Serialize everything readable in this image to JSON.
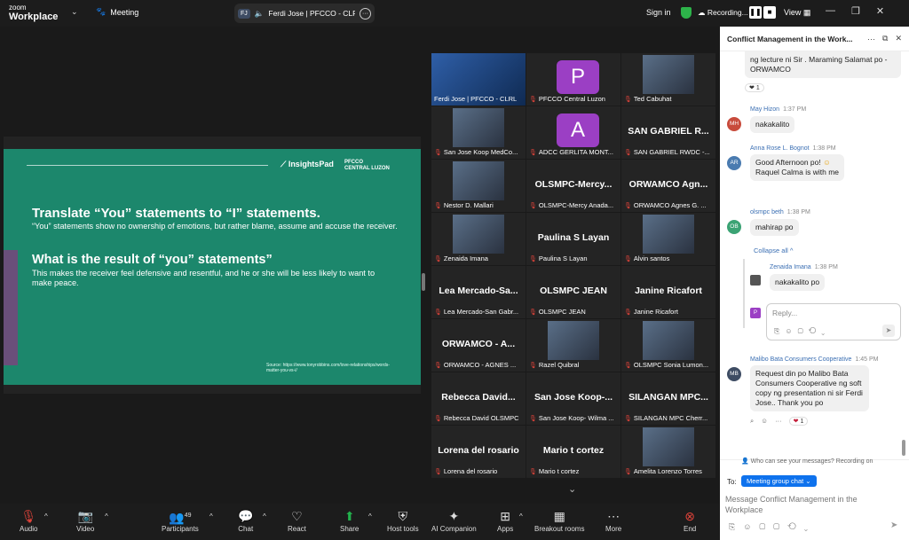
{
  "topbar": {
    "brand_small": "zoom",
    "brand_large": "Workplace",
    "meeting_label": "Meeting",
    "speaker_initials": "FJ",
    "speaker_name": "Ferdi Jose | PFCCO - CLRL's s",
    "signin": "Sign in",
    "recording": "Recording...",
    "view": "View"
  },
  "slide": {
    "logo1": "InsightsPad",
    "logo2_top": "PFCCO",
    "logo2_bottom": "CENTRAL LUZON",
    "heading1": "Translate “You” statements to “I” statements.",
    "para1": "“You” statements show no ownership of emotions, but rather blame, assume and accuse the receiver.",
    "heading2": "What is the result of “you” statements”",
    "para2": "This makes the receiver  feel defensive and resentful, and he or she will be less likely to want to make peace.",
    "source": "Source: https://www.tonyrobbins.com/love-relationships/words-matter-you-vs-i/"
  },
  "tiles": [
    {
      "name": "Ferdi Jose | PFCCO - CLRL",
      "kind": "photo",
      "active": true,
      "muted": false
    },
    {
      "name": "PFCCO Central Luzon",
      "kind": "avatar",
      "letter": "P",
      "color": "#9b3fc4",
      "muted": true
    },
    {
      "name": "Ted Cabuhat",
      "kind": "photo",
      "muted": true
    },
    {
      "name": "San Jose Koop MedCo...",
      "kind": "photo",
      "muted": true
    },
    {
      "name": "ADCC GERLITA MONT...",
      "kind": "avatar",
      "letter": "A",
      "color": "#9b3fc4",
      "muted": true
    },
    {
      "name": "SAN GABRIEL RWDC -...",
      "kind": "text",
      "big": "SAN GABRIEL R...",
      "muted": true
    },
    {
      "name": "Nestor D. Mallari",
      "kind": "photo",
      "muted": true
    },
    {
      "name": "OLSMPC-Mercy Anada...",
      "kind": "text",
      "big": "OLSMPC-Mercy...",
      "muted": true
    },
    {
      "name": "ORWAMCO Agnes G. ...",
      "kind": "text",
      "big": "ORWAMCO  Agn...",
      "muted": true
    },
    {
      "name": "Zenaida Imana",
      "kind": "photo",
      "muted": true
    },
    {
      "name": "Paulina S Layan",
      "kind": "text",
      "big": "Paulina S Layan",
      "muted": true
    },
    {
      "name": "Alvin santos",
      "kind": "photo",
      "muted": true
    },
    {
      "name": "Lea Mercado-San Gabr...",
      "kind": "text",
      "big": "Lea  Mercado-Sa...",
      "muted": true
    },
    {
      "name": "OLSMPC JEAN",
      "kind": "text",
      "big": "OLSMPC JEAN",
      "muted": true
    },
    {
      "name": "Janine Ricafort",
      "kind": "text",
      "big": "Janine Ricafort",
      "muted": true
    },
    {
      "name": "ORWAMCO - AGNES ...",
      "kind": "text",
      "big": "ORWAMCO  - A...",
      "muted": true
    },
    {
      "name": "Razel Quibral",
      "kind": "photo",
      "muted": true
    },
    {
      "name": "OLSMPC Sonia Lumon...",
      "kind": "photo",
      "muted": true
    },
    {
      "name": "Rebecca David OLSMPC",
      "kind": "text",
      "big": "Rebecca  David...",
      "muted": true
    },
    {
      "name": "San Jose Koop- Wilma ...",
      "kind": "text",
      "big": "San Jose Koop-...",
      "muted": true
    },
    {
      "name": "SILANGAN MPC Cherr...",
      "kind": "text",
      "big": "SILANGAN  MPC...",
      "muted": true
    },
    {
      "name": "Lorena del rosario",
      "kind": "text",
      "big": "Lorena del rosario",
      "muted": true
    },
    {
      "name": "Mario t cortez",
      "kind": "text",
      "big": "Mario t cortez",
      "muted": true
    },
    {
      "name": "Amelita Lorenzo Torres",
      "kind": "photo",
      "muted": true
    }
  ],
  "toolbar": {
    "audio": "Audio",
    "video": "Video",
    "participants": "Participants",
    "participants_count": "49",
    "chat": "Chat",
    "react": "React",
    "share": "Share",
    "host_tools": "Host tools",
    "ai": "AI Companion",
    "apps": "Apps",
    "breakout": "Breakout rooms",
    "more": "More",
    "end": "End"
  },
  "chat": {
    "title": "Conflict Management in the Work...",
    "m0_text": "ng lecture ni Sir . Maraming Salamat po - ORWAMCO",
    "m0_react": "1",
    "m1_initials": "MH",
    "m1_name": "May Hizon",
    "m1_time": "1:37 PM",
    "m1_text": "nakakalito",
    "m2_initials": "AR",
    "m2_name": "Anna Rose L. Bognot",
    "m2_time": "1:38 PM",
    "m2_text": "Good Afternoon po!",
    "m2_text2": "Raquel Calma is with me",
    "m3_initials": "OB",
    "m3_name": "olsmpc beth",
    "m3_time": "1:38 PM",
    "m3_text": "mahirap po",
    "collapse": "Collapse all",
    "r1_name": "Zenaida Imana",
    "r1_time": "1:38 PM",
    "r1_text": "nakakalito po",
    "reply_placeholder": "Reply...",
    "m4_initials": "MB",
    "m4_name": "Malibo Bata Consumers Cooperative",
    "m4_time": "1:45 PM",
    "m4_text": "Request din po Malibo Bata Consumers Cooperative ng soft copy ng presentation ni sir Ferdi Jose.. Thank you po",
    "m4_react": "1",
    "who_can_see": "Who can see your messages? Recording on",
    "to_label": "To:",
    "to_value": "Meeting group chat",
    "input_placeholder": "Message Conflict Management in the Workplace"
  },
  "colors": {
    "slide_bg": "#1c876c",
    "active_border": "#2ac28b",
    "end_red": "#e0433a",
    "share_green": "#22b14c",
    "link_blue": "#3b6fb3"
  }
}
